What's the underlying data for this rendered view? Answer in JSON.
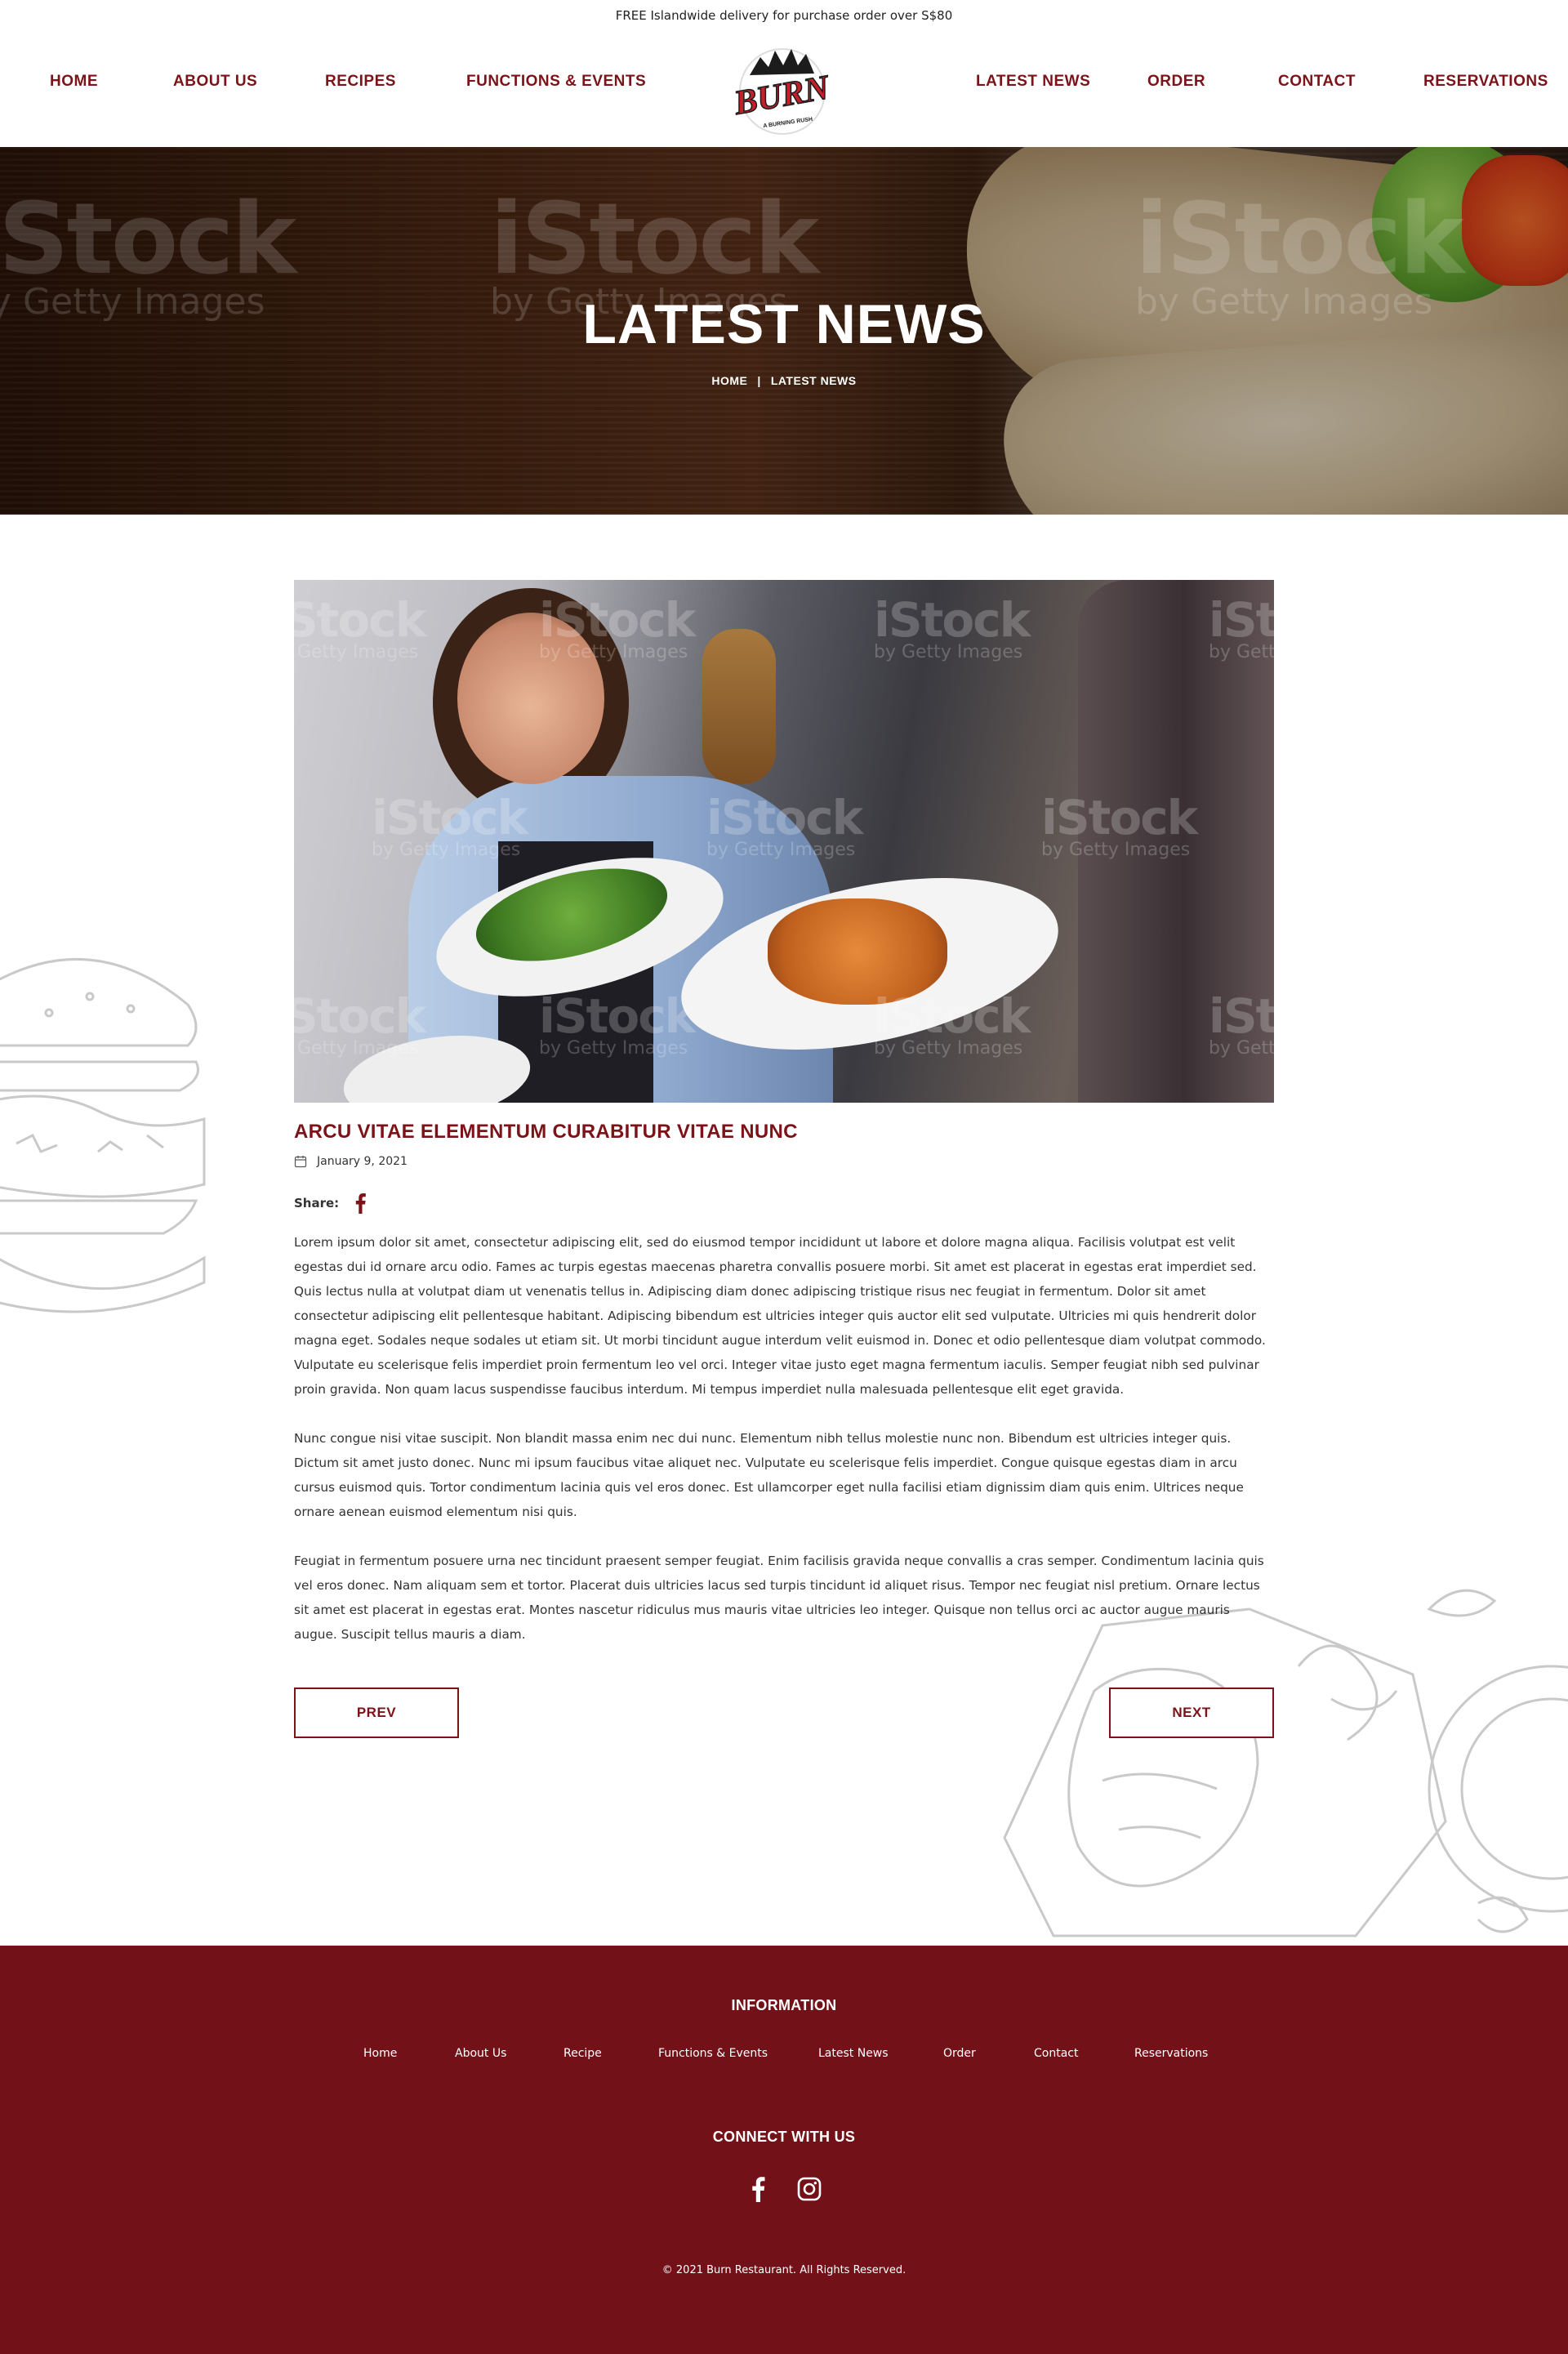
{
  "topbar": {
    "text": "FREE Islandwide delivery for purchase order over S$80"
  },
  "nav": {
    "left": [
      "HOME",
      "ABOUT US",
      "RECIPES",
      "FUNCTIONS & EVENTS"
    ],
    "right": [
      "LATEST NEWS",
      "ORDER",
      "CONTACT",
      "RESERVATIONS"
    ]
  },
  "logo": {
    "name": "BURN",
    "tagline": "A BURNING RUSH"
  },
  "hero": {
    "title": "LATEST NEWS",
    "breadcrumb": [
      "HOME",
      "LATEST NEWS"
    ],
    "breadcrumb_separator": "|",
    "watermark": {
      "brand": "iStock",
      "by": "by Getty Images"
    }
  },
  "article": {
    "title": "ARCU VITAE ELEMENTUM CURABITUR VITAE NUNC",
    "date": "January 9, 2021",
    "share_label": "Share:",
    "paragraphs": [
      "Lorem ipsum dolor sit amet, consectetur adipiscing elit, sed do eiusmod tempor incididunt ut labore et dolore magna aliqua. Facilisis volutpat est velit egestas dui id ornare arcu odio. Fames ac turpis egestas maecenas pharetra convallis posuere morbi. Sit amet est placerat in egestas erat imperdiet sed. Quis lectus nulla at volutpat diam ut venenatis tellus in. Adipiscing diam donec adipiscing tristique risus nec feugiat in fermentum. Dolor sit amet consectetur adipiscing elit pellentesque habitant. Adipiscing bibendum est ultricies integer quis auctor elit sed vulputate. Ultricies mi quis hendrerit dolor magna eget. Sodales neque sodales ut etiam sit. Ut morbi tincidunt augue interdum velit euismod in. Donec et odio pellentesque diam volutpat commodo. Vulputate eu scelerisque felis imperdiet proin fermentum leo vel orci. Integer vitae justo eget magna fermentum iaculis. Semper feugiat nibh sed pulvinar proin gravida. Non quam lacus suspendisse faucibus interdum. Mi tempus imperdiet nulla malesuada pellentesque elit eget gravida.",
      "Nunc congue nisi vitae suscipit. Non blandit massa enim nec dui nunc. Elementum nibh tellus molestie nunc non. Bibendum est ultricies integer quis. Dictum sit amet justo donec. Nunc mi ipsum faucibus vitae aliquet nec. Vulputate eu scelerisque felis imperdiet. Congue quisque egestas diam in arcu cursus euismod quis. Tortor condimentum lacinia quis vel eros donec. Est ullamcorper eget nulla facilisi etiam dignissim diam quis enim. Ultrices neque ornare aenean euismod elementum nisi quis.",
      "Feugiat in fermentum posuere urna nec tincidunt praesent semper feugiat. Enim facilisis gravida neque convallis a cras semper. Condimentum lacinia quis vel eros donec. Nam aliquam sem et tortor. Placerat duis ultricies lacus sed turpis tincidunt id aliquet risus. Tempor nec feugiat nisl pretium. Ornare lectus sit amet est placerat in egestas erat. Montes nascetur ridiculus mus mauris vitae ultricies leo integer. Quisque non tellus orci ac auctor augue mauris augue. Suscipit tellus mauris a diam."
    ],
    "prev_label": "PREV",
    "next_label": "NEXT"
  },
  "footer": {
    "info_heading": "INFORMATION",
    "links": [
      "Home",
      "About Us",
      "Recipe",
      "Functions & Events",
      "Latest News",
      "Order",
      "Contact",
      "Reservations"
    ],
    "connect_heading": "CONNECT WITH US",
    "social_icons": [
      "facebook-icon",
      "instagram-icon"
    ],
    "copyright": "© 2021 Burn Restaurant. All Rights Reserved."
  },
  "colors": {
    "brand": "#7b1318",
    "footer_bg": "#721118",
    "text": "#333333",
    "white": "#ffffff"
  }
}
